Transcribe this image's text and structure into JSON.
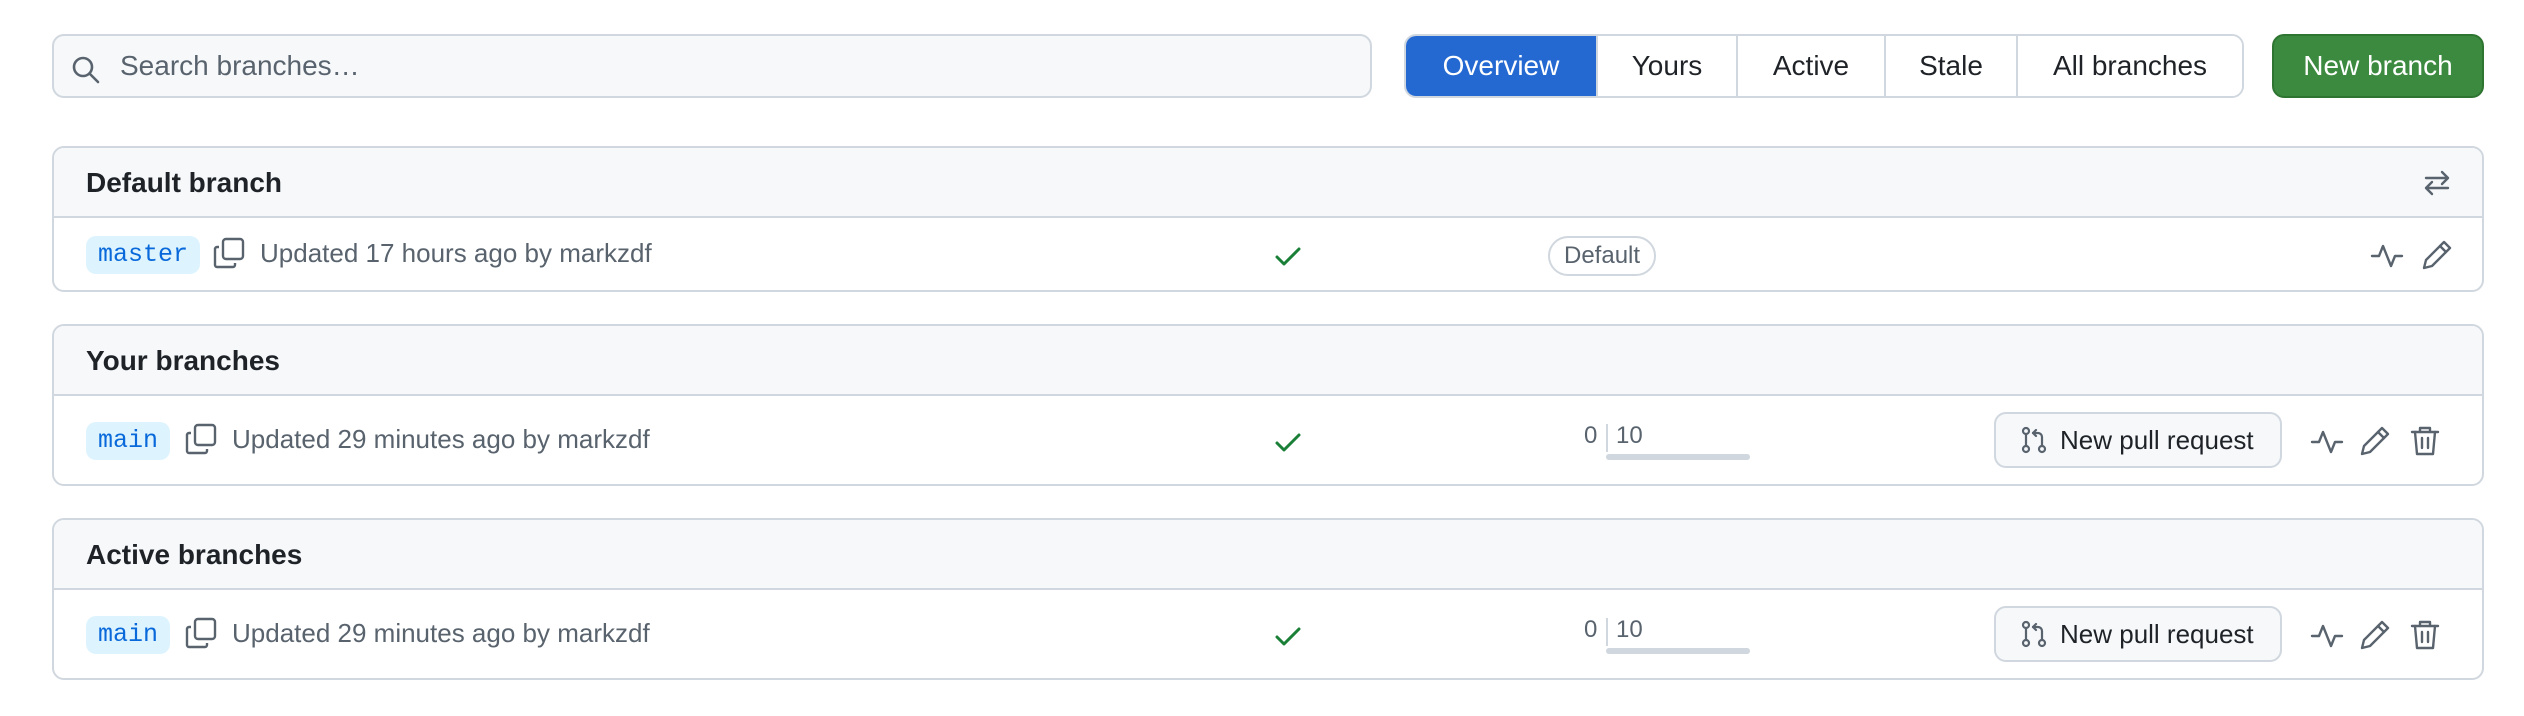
{
  "search": {
    "placeholder": "Search branches…",
    "value": ""
  },
  "tabs": [
    {
      "label": "Overview",
      "selected": true
    },
    {
      "label": "Yours",
      "selected": false
    },
    {
      "label": "Active",
      "selected": false
    },
    {
      "label": "Stale",
      "selected": false
    },
    {
      "label": "All branches",
      "selected": false
    }
  ],
  "new_branch_label": "New branch",
  "colors": {
    "accent": "#2469d2",
    "primary_button": "#3b8a3f",
    "success": "#1a7f37",
    "chip_bg": "#ddf4ff",
    "chip_text": "#0969da"
  },
  "sections": {
    "default": {
      "title": "Default branch",
      "header_icon": "arrow-switch-icon",
      "branch": {
        "name": "master",
        "updated": "Updated 17 hours ago by markzdf",
        "status": "check",
        "badge": "Default"
      }
    },
    "yours": {
      "title": "Your branches",
      "branch": {
        "name": "main",
        "updated": "Updated 29 minutes ago by markzdf",
        "status": "check",
        "ahead": "0",
        "behind": "10",
        "pr_label": "New pull request"
      }
    },
    "active": {
      "title": "Active branches",
      "branch": {
        "name": "main",
        "updated": "Updated 29 minutes ago by markzdf",
        "status": "check",
        "ahead": "0",
        "behind": "10",
        "pr_label": "New pull request"
      }
    }
  }
}
